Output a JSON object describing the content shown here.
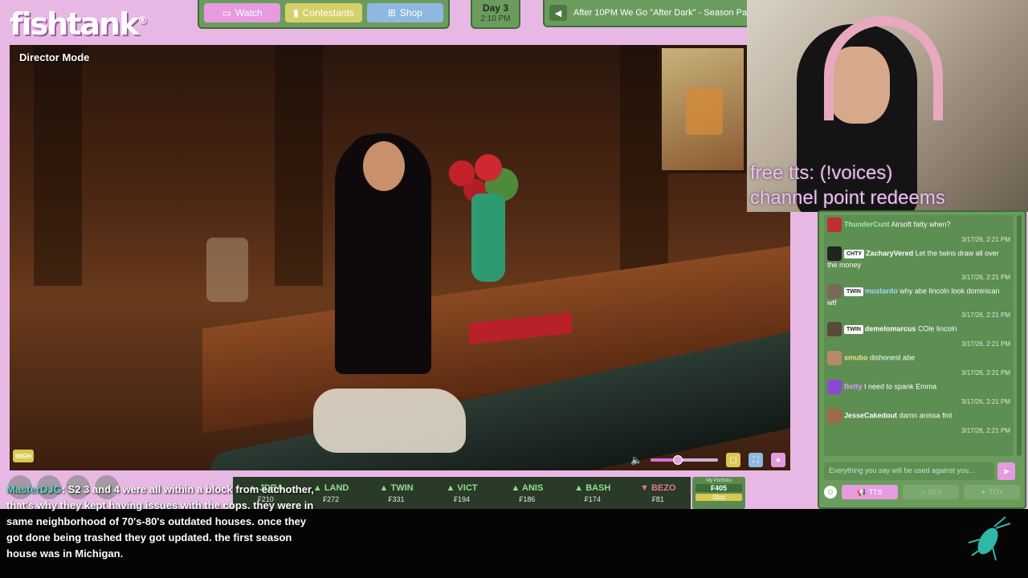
{
  "header": {
    "logo": "fishtank",
    "logo_mark": "®",
    "nav": [
      {
        "label": "Watch",
        "icon": "tv-icon"
      },
      {
        "label": "Contestants",
        "icon": "contestants-icon"
      },
      {
        "label": "Shop",
        "icon": "cart-icon"
      }
    ],
    "day": "Day 3",
    "time": "2:10 PM",
    "ticker": "After 10PM We Go \"After Dark\" - Season Pass"
  },
  "player": {
    "mode_label": "Director Mode",
    "hd_badge": "HIGH",
    "volume_level": 0.4
  },
  "webcam": {
    "overlay_line1": "free tts: (!voices)",
    "overlay_line2": "channel point redeems"
  },
  "chat": {
    "messages": [
      {
        "user": "ThunderCunt",
        "badge": "",
        "text": "Airsoft fatty when?",
        "ts": "3/17/26, 2:21 PM",
        "color": "#9ef0a0",
        "avatar": "#c03030"
      },
      {
        "user": "ZacharyVered",
        "badge": "CHTY",
        "text": "Let the twins draw all over the money",
        "ts": "3/17/26, 2:21 PM",
        "color": "#ffffff",
        "avatar": "#222222"
      },
      {
        "user": "mustardo",
        "badge": "TWIN",
        "text": "why abe lincoln look dominican wtf",
        "ts": "3/17/26, 2:21 PM",
        "color": "#a0d8ff",
        "avatar": "#7a6a5a"
      },
      {
        "user": "demelomarcus",
        "badge": "TWIN",
        "text": "COle lincoln",
        "ts": "3/17/26, 2:21 PM",
        "color": "#ffffff",
        "avatar": "#5a4a3a"
      },
      {
        "user": "smubo",
        "badge": "",
        "text": "dishonest abe",
        "ts": "3/17/26, 2:21 PM",
        "color": "#f0e08a",
        "avatar": "#b88a6a"
      },
      {
        "user": "Betty",
        "badge": "",
        "text": "I need to spank Emma",
        "ts": "3/17/26, 2:21 PM",
        "color": "#d8a0ff",
        "avatar": "#8a4ad0"
      },
      {
        "user": "JesseCakedout",
        "badge": "",
        "text": "damn anissa fml",
        "ts": "3/17/26, 2:21 PM",
        "color": "#ffffff",
        "avatar": "#a06a4a"
      }
    ],
    "input_placeholder": "Everything you say will be used against you...",
    "tools": [
      {
        "label": "TTS"
      },
      {
        "label": "SFX"
      },
      {
        "label": "TOY"
      }
    ]
  },
  "stocks": [
    {
      "name": "JDRA",
      "price": "₣210",
      "dir": "up"
    },
    {
      "name": "LAND",
      "price": "₣272",
      "dir": "up"
    },
    {
      "name": "TWIN",
      "price": "₣331",
      "dir": "up"
    },
    {
      "name": "VICT",
      "price": "₣194",
      "dir": "up"
    },
    {
      "name": "ANIS",
      "price": "₣186",
      "dir": "up"
    },
    {
      "name": "BASH",
      "price": "₣174",
      "dir": "up"
    },
    {
      "name": "BEZO",
      "price": "₣81",
      "dir": "down"
    }
  ],
  "portfolio": {
    "label": "My Portfolio",
    "value": "₣405",
    "button": "Stox"
  },
  "caption": {
    "user": "MasterDJG",
    "text": ": S2 3 and 4 were all within a block from eachother, that's why they kept having issues with the cops. they were in same neighborhood of 70's-80's outdated houses. once they got done being trashed they got updated. the first season house was in Michigan."
  }
}
